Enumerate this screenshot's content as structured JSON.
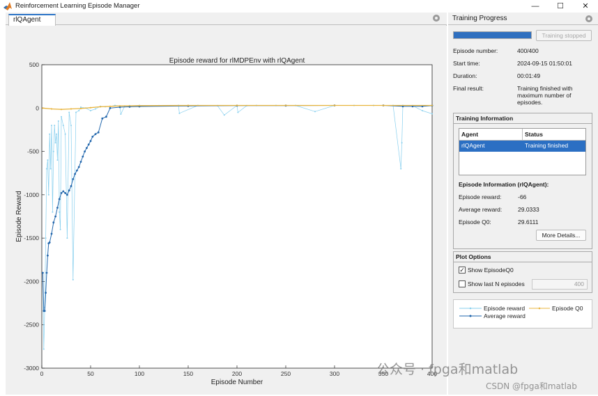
{
  "window": {
    "title": "Reinforcement Learning Episode Manager",
    "controls": {
      "minimize": "—",
      "maximize": "☐",
      "close": "✕"
    }
  },
  "doc_tab": {
    "label": "rlQAgent"
  },
  "training_progress": {
    "title": "Training Progress",
    "progress_fraction": 1.0,
    "stop_button_label": "Training stopped",
    "fields": [
      {
        "label": "Episode number:",
        "value": "400/400"
      },
      {
        "label": "Start time:",
        "value": "2024-09-15 01:50:01"
      },
      {
        "label": "Duration:",
        "value": "00:01:49"
      },
      {
        "label": "Final result:",
        "value": "Training finished with maximum number of episodes."
      }
    ]
  },
  "training_information": {
    "title": "Training Information",
    "table": {
      "columns": [
        "Agent",
        "Status"
      ],
      "rows": [
        {
          "agent": "rlQAgent",
          "status": "Training finished"
        }
      ]
    },
    "episode_info_title": "Episode Information (rlQAgent):",
    "episode_fields": [
      {
        "label": "Episode reward:",
        "value": "-66"
      },
      {
        "label": "Average reward:",
        "value": "29.0333"
      },
      {
        "label": "Episode Q0:",
        "value": "29.6111"
      }
    ],
    "more_details_label": "More Details..."
  },
  "plot_options": {
    "title": "Plot Options",
    "show_q0_label": "Show EpisodeQ0",
    "show_q0_checked": true,
    "show_last_n_label": "Show last N episodes",
    "show_last_n_checked": false,
    "last_n_value": "400"
  },
  "legend": {
    "episode_reward": "Episode reward",
    "episode_q0": "Episode Q0",
    "average_reward": "Average reward"
  },
  "colors": {
    "episode_reward": "#87cfee",
    "average_reward": "#2166ac",
    "episode_q0": "#e8b43c",
    "accent": "#2b6fc3"
  },
  "watermarks": {
    "wechat": "公众号 · fpga和matlab",
    "csdn": "CSDN @fpga和matlab"
  },
  "chart_data": {
    "type": "line",
    "title": "Episode reward for rlMDPEnv with rlQAgent",
    "xlabel": "Episode Number",
    "ylabel": "Episode Reward",
    "xlim": [
      0,
      400
    ],
    "ylim": [
      -3000,
      500
    ],
    "x_ticks": [
      0,
      50,
      100,
      150,
      200,
      250,
      300,
      350,
      400
    ],
    "y_ticks": [
      500,
      0,
      -500,
      -1000,
      -1500,
      -2000,
      -2500,
      -3000
    ],
    "grid": false,
    "series": [
      {
        "name": "Episode reward",
        "x": [
          1,
          2,
          3,
          4,
          5,
          6,
          7,
          8,
          9,
          10,
          11,
          12,
          13,
          14,
          15,
          16,
          17,
          18,
          19,
          20,
          22,
          24,
          26,
          28,
          30,
          32,
          35,
          38,
          40,
          45,
          50,
          55,
          60,
          65,
          70,
          75,
          80,
          81,
          85,
          90,
          100,
          120,
          140,
          141,
          160,
          180,
          187,
          200,
          201,
          210,
          220,
          240,
          260,
          280,
          300,
          320,
          340,
          360,
          368,
          369,
          370,
          380,
          390,
          400
        ],
        "y": [
          -1900,
          -2780,
          -2300,
          -1500,
          -700,
          -600,
          -1000,
          -300,
          -700,
          -200,
          -1200,
          -500,
          -200,
          -400,
          -300,
          -600,
          -150,
          -1200,
          -1400,
          -100,
          -200,
          -300,
          -1500,
          -50,
          -200,
          -1980,
          -50,
          -30,
          10,
          0,
          -30,
          -10,
          20,
          15,
          20,
          30,
          25,
          -70,
          25,
          28,
          30,
          28,
          30,
          -60,
          30,
          28,
          -80,
          30,
          -50,
          28,
          30,
          30,
          30,
          -40,
          30,
          30,
          30,
          30,
          -700,
          -400,
          30,
          28,
          -30,
          -66
        ]
      },
      {
        "name": "Average reward",
        "x": [
          1,
          2,
          3,
          4,
          5,
          6,
          7,
          8,
          10,
          12,
          14,
          16,
          18,
          20,
          22,
          24,
          26,
          28,
          30,
          32,
          34,
          36,
          38,
          40,
          42,
          44,
          46,
          48,
          50,
          52,
          55,
          58,
          62,
          66,
          70,
          80,
          90,
          100,
          150,
          200,
          250,
          300,
          350,
          370,
          380,
          390,
          400
        ],
        "y": [
          -1900,
          -2340,
          -2340,
          -2130,
          -1900,
          -1700,
          -1560,
          -1550,
          -1450,
          -1320,
          -1250,
          -1150,
          -1050,
          -980,
          -960,
          -980,
          -1000,
          -950,
          -900,
          -820,
          -760,
          -720,
          -680,
          -620,
          -560,
          -500,
          -460,
          -420,
          -380,
          -330,
          -300,
          -280,
          -120,
          -100,
          0,
          10,
          15,
          18,
          25,
          28,
          29,
          30,
          30,
          20,
          20,
          20,
          29
        ]
      },
      {
        "name": "Episode Q0",
        "x": [
          1,
          10,
          20,
          30,
          40,
          50,
          60,
          70,
          80,
          100,
          150,
          200,
          250,
          300,
          350,
          400
        ],
        "y": [
          0,
          -10,
          -15,
          -10,
          -5,
          5,
          15,
          20,
          25,
          28,
          30,
          30,
          30,
          30,
          30,
          30
        ]
      }
    ]
  }
}
